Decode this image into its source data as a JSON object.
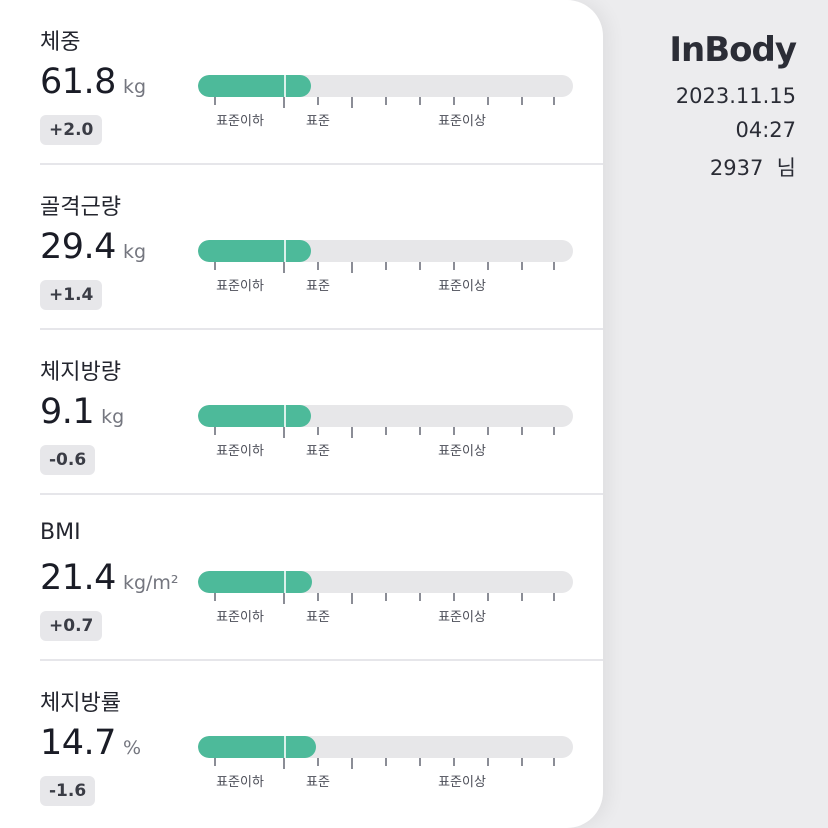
{
  "brand": {
    "logo": "InBody"
  },
  "session": {
    "date": "2023.11.15",
    "time": "04:27",
    "user": "2937  님"
  },
  "scale_labels": {
    "below": "표준이하",
    "standard": "표준",
    "above": "표준이상"
  },
  "metrics": [
    {
      "label": "체중",
      "value": "61.8",
      "unit": "kg",
      "delta": "+2.0",
      "fill_ratio": 0.3
    },
    {
      "label": "골격근량",
      "value": "29.4",
      "unit": "kg",
      "delta": "+1.4",
      "fill_ratio": 0.3
    },
    {
      "label": "체지방량",
      "value": "9.1",
      "unit": "kg",
      "delta": "-0.6",
      "fill_ratio": 0.3
    },
    {
      "label": "BMI",
      "value": "21.4",
      "unit": "kg/m²",
      "delta": "+0.7",
      "fill_ratio": 0.305
    },
    {
      "label": "체지방률",
      "value": "14.7",
      "unit": "%",
      "delta": "-1.6",
      "fill_ratio": 0.315
    }
  ],
  "colors": {
    "bar_fill": "#4dba9a",
    "bar_track": "#e7e7e9",
    "delta_bg": "#e7e7ea"
  }
}
